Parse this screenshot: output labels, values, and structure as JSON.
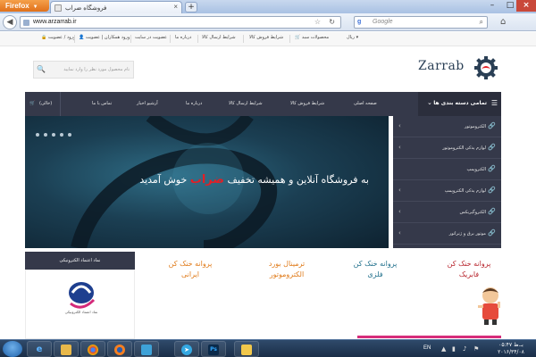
{
  "browser": {
    "menu_label": "Firefox",
    "tab_title": "فروشگاه ضراب",
    "url": "www.arzarrab.ir",
    "search_engine_placeholder": "Google",
    "search_engine_letter": "g"
  },
  "topbar": {
    "items": [
      "ورود / عضویت",
      "ورود همکاران | عضویت",
      "عضویت در سایت",
      "درباره ما",
      "شرایط ارسال کالا",
      "شرایط فروش کالا",
      "محصولات سبد"
    ],
    "currency": "ریال"
  },
  "header": {
    "search_placeholder": "نام محصول مورد نظر را وارد نمایید",
    "logo_text": "Zarrab"
  },
  "mainnav": {
    "cart_label": "(خالی)",
    "items": [
      "تماس با ما",
      "آرشیو اخبار",
      "درباره ما",
      "شرایط ارسال کالا",
      "شرایط فروش کالا",
      "صفحه اصلی"
    ],
    "categories_label": "تمامی دسته بندی ها"
  },
  "categories": [
    {
      "label": "الکتروموتور"
    },
    {
      "label": "لوازم یدکی الکتروموتور"
    },
    {
      "label": "الکتروپمپ"
    },
    {
      "label": "لوازم یدکی الکتروپمپ"
    },
    {
      "label": "الکتروگیربکس"
    },
    {
      "label": "موتور برق و ژنراتور"
    }
  ],
  "slider": {
    "tagline_before": "به فروشگاه آنلاین و همیشه تخفیف",
    "tagline_brand": "ضراب",
    "tagline_after": "خوش آمدید",
    "dots": 5
  },
  "trust": {
    "heading": "نماد اعتماد الکترونیکی",
    "caption": "نماد اعتماد الکترونیکی"
  },
  "products": [
    {
      "title_line1": "پروانه خنک کن",
      "title_line2": "ایرانی"
    },
    {
      "title_line1": "ترمینال بورد",
      "title_line2": "الکتروموتور"
    },
    {
      "title_line1": "پروانه خنک کن",
      "title_line2": "فلزی"
    },
    {
      "title_line1": "پروانه خنک کن",
      "title_line2": "فابریک"
    }
  ],
  "taskbar": {
    "lang": "EN",
    "clock_time": "بـ.ظ ۰۵:۴۷",
    "clock_date": "۲۰۱۶/۳۴/۰۸"
  },
  "colors": {
    "nav_bg": "#35394a",
    "brand_red": "#e21f26",
    "accent_orange": "#e07b1a",
    "accent_teal": "#1f6f8b"
  }
}
